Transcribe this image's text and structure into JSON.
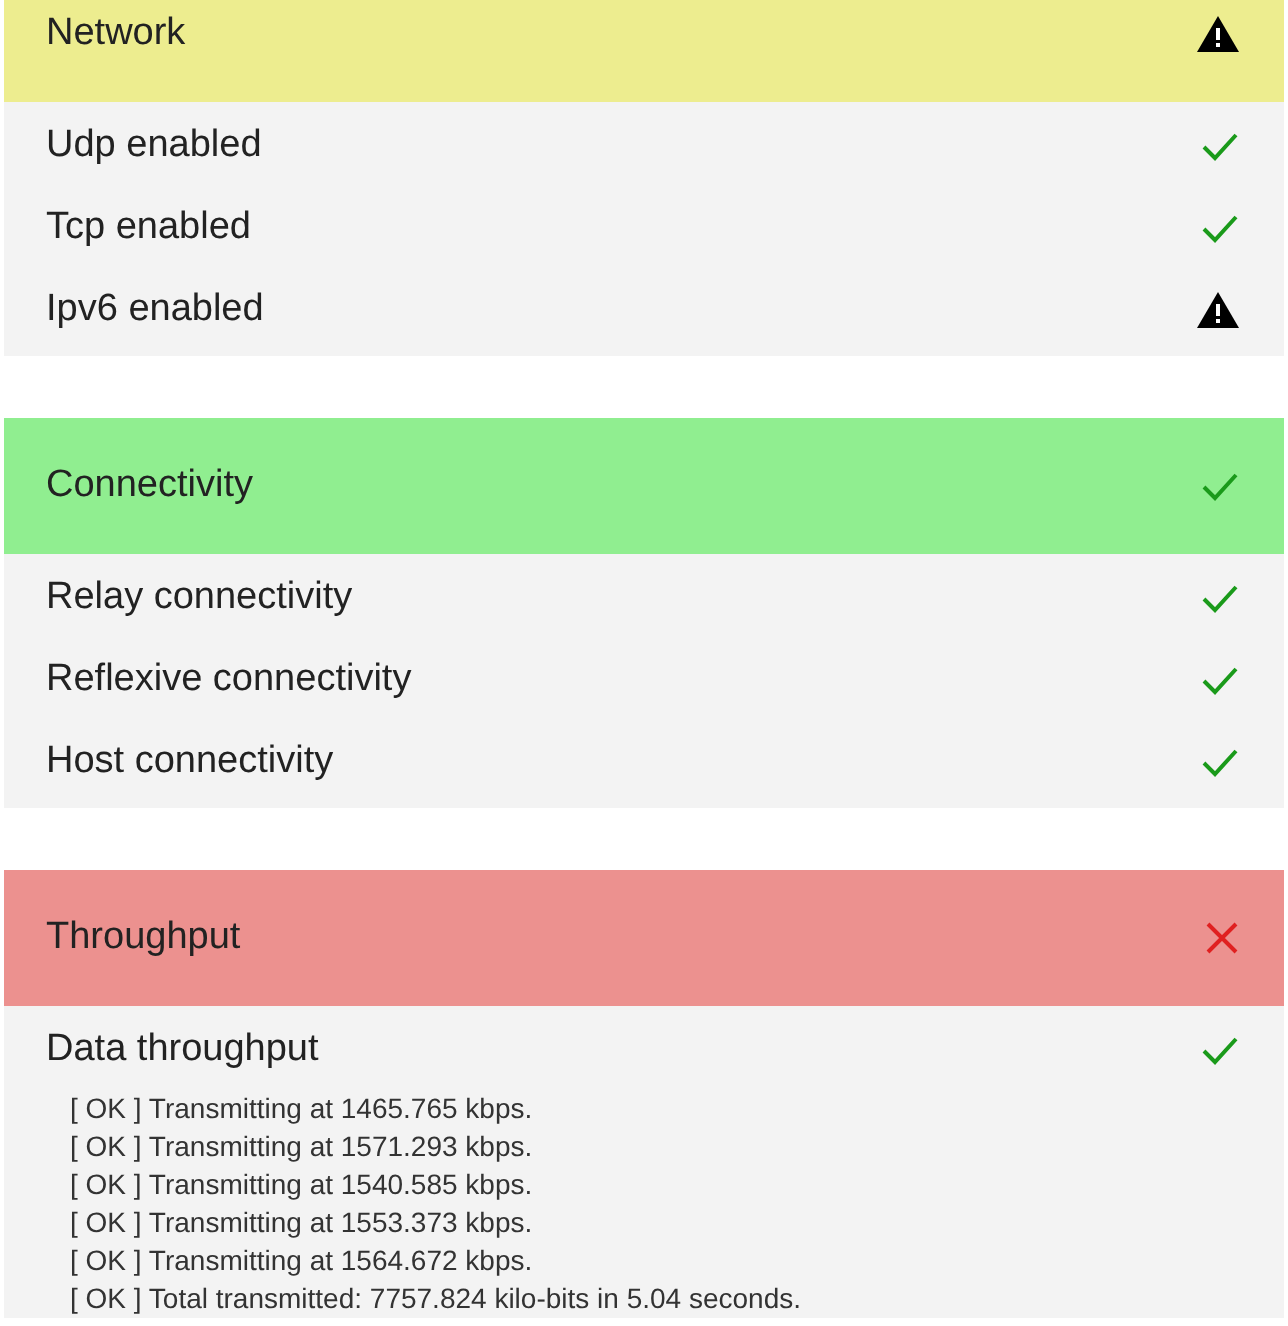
{
  "sections": [
    {
      "title": "Network",
      "kind": "warning",
      "items": [
        {
          "label": "Udp enabled",
          "kind": "ok"
        },
        {
          "label": "Tcp enabled",
          "kind": "ok"
        },
        {
          "label": "Ipv6 enabled",
          "kind": "warning"
        }
      ]
    },
    {
      "title": "Connectivity",
      "kind": "ok",
      "items": [
        {
          "label": "Relay connectivity",
          "kind": "ok"
        },
        {
          "label": "Reflexive connectivity",
          "kind": "ok"
        },
        {
          "label": "Host connectivity",
          "kind": "ok"
        }
      ]
    },
    {
      "title": "Throughput",
      "kind": "error",
      "items": [
        {
          "label": "Data throughput",
          "kind": "ok",
          "log": [
            "[ OK ] Transmitting at 1465.765 kbps.",
            "[ OK ] Transmitting at 1571.293 kbps.",
            "[ OK ] Transmitting at 1540.585 kbps.",
            "[ OK ] Transmitting at 1553.373 kbps.",
            "[ OK ] Transmitting at 1564.672 kbps.",
            "[ OK ] Total transmitted: 7757.824 kilo-bits in 5.04 seconds."
          ]
        }
      ]
    }
  ]
}
